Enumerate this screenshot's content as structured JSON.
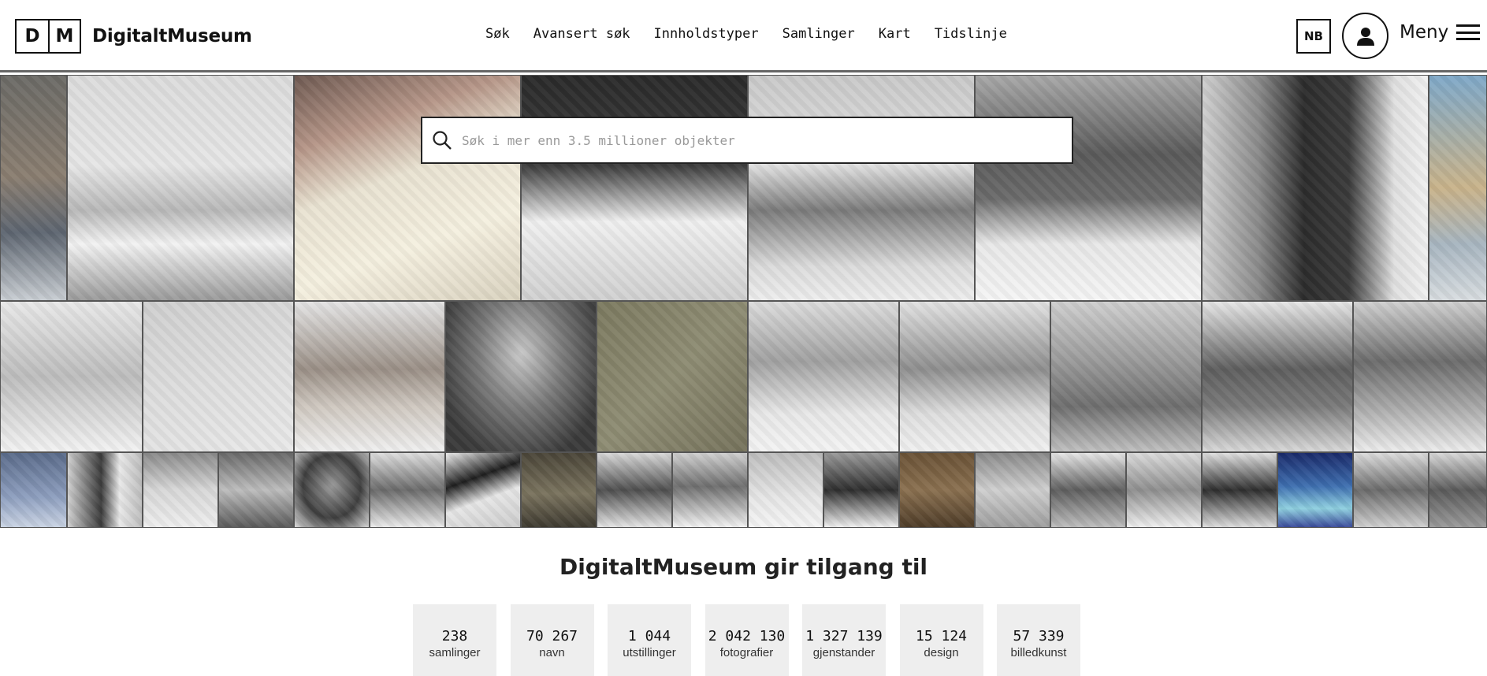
{
  "header": {
    "logo_letters": [
      "D",
      "M"
    ],
    "logo_text": "DigitaltMuseum",
    "nav": [
      {
        "label": "Søk",
        "name": "nav-search"
      },
      {
        "label": "Avansert søk",
        "name": "nav-advanced-search"
      },
      {
        "label": "Innholdstyper",
        "name": "nav-content-types"
      },
      {
        "label": "Samlinger",
        "name": "nav-collections"
      },
      {
        "label": "Kart",
        "name": "nav-map"
      },
      {
        "label": "Tidslinje",
        "name": "nav-timeline"
      }
    ],
    "language": "NB",
    "menu_label": "Meny"
  },
  "search": {
    "placeholder": "Søk i mer enn 3.5 millioner objekter",
    "icon": "search-icon"
  },
  "stats": {
    "title": "DigitaltMuseum gir tilgang til",
    "items": [
      {
        "value": "238",
        "label": "samlinger"
      },
      {
        "value": "70 267",
        "label": "navn"
      },
      {
        "value": "1 044",
        "label": "utstillinger"
      },
      {
        "value": "2 042 130",
        "label": "fotografier"
      },
      {
        "value": "1 327 139",
        "label": "gjenstander"
      },
      {
        "value": "15 124",
        "label": "design"
      },
      {
        "value": "57 339",
        "label": "billedkunst"
      }
    ]
  },
  "colors": {
    "text": "#111111",
    "stat_background": "#eeeeee",
    "header_border": "#666666"
  }
}
